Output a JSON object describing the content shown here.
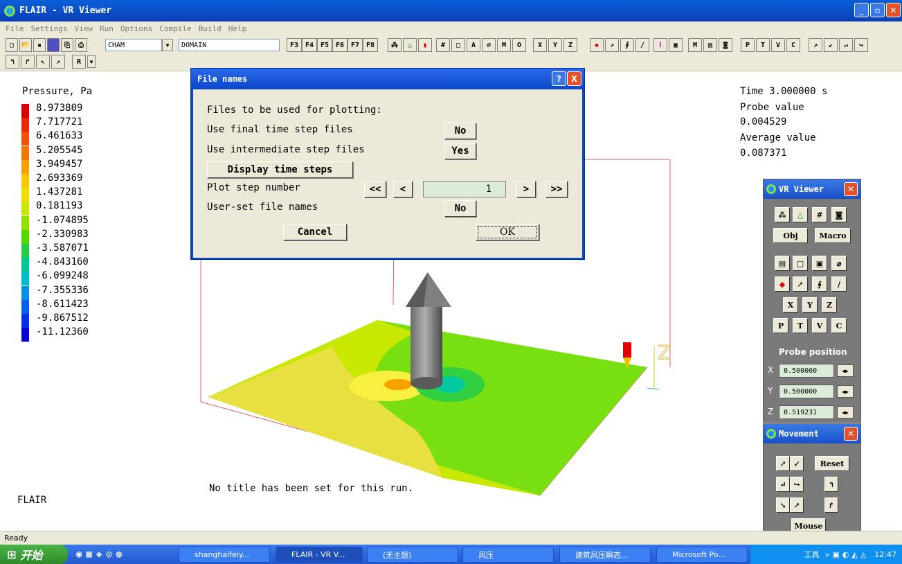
{
  "window": {
    "title": "FLAIR - VR Viewer"
  },
  "menu": [
    "File",
    "Settings",
    "View",
    "Run",
    "Options",
    "Compile",
    "Build",
    "Help"
  ],
  "toolbar": {
    "combo1": "CHAM",
    "combo2": "DOMAIN",
    "fkeys": [
      "F3",
      "F4",
      "F5",
      "F6",
      "F7",
      "F8"
    ],
    "letters": [
      "M",
      "O",
      "X",
      "Y",
      "Z",
      "M",
      "P",
      "T",
      "V",
      "C",
      "R"
    ]
  },
  "legend": {
    "title": "Pressure, Pa",
    "values": [
      "8.973809",
      "7.717721",
      "6.461633",
      "5.205545",
      "3.949457",
      "2.693369",
      "1.437281",
      "0.181193",
      "-1.074895",
      "-2.330983",
      "-3.587071",
      "-4.843160",
      "-6.099248",
      "-7.355336",
      "-8.611423",
      "-9.867512",
      "-11.12360"
    ],
    "colors": [
      "#d80000",
      "#e82800",
      "#f05000",
      "#f07800",
      "#f8a000",
      "#f8c800",
      "#f0e000",
      "#c8e800",
      "#90e000",
      "#50d800",
      "#20d040",
      "#00c890",
      "#00b8d0",
      "#0090e8",
      "#0060f0",
      "#0030e8",
      "#0000d8"
    ]
  },
  "info": {
    "time": "Time 3.000000 s",
    "probe_label": "Probe value",
    "probe_value": "0.004529",
    "avg_label": "Average value",
    "avg_value": "0.087371",
    "run_title": "No title has been set for this run.",
    "app_label": "FLAIR",
    "axis_z": "Z"
  },
  "dialog": {
    "title": "File names",
    "help": "?",
    "close": "X",
    "heading": "Files to be used for plotting:",
    "final_label": "Use final time step files",
    "final_value": "No",
    "intermediate_label": "Use intermediate step files",
    "intermediate_value": "Yes",
    "display_steps": "Display time steps",
    "step_label": "Plot step number",
    "step_first": "<<",
    "step_prev": "<",
    "step_value": "1",
    "step_next": ">",
    "step_last": ">>",
    "userset_label": "User-set file names",
    "userset_value": "No",
    "cancel": "Cancel",
    "ok": "OK"
  },
  "vr_panel": {
    "title": "VR Viewer",
    "obj": "Obj",
    "macro": "Macro",
    "x": "X",
    "y": "Y",
    "z": "Z",
    "p": "P",
    "t": "T",
    "v": "V",
    "c": "C",
    "probe_title": "Probe position",
    "probe_x": "0.500000",
    "probe_y": "0.500000",
    "probe_z": "0.519231"
  },
  "movement_panel": {
    "title": "Movement",
    "reset": "Reset",
    "mouse": "Mouse"
  },
  "statusbar": {
    "text": "Ready"
  },
  "taskbar": {
    "start": "开始",
    "tasks": [
      "shanghaifeiy...",
      "FLAIR - VR V...",
      "(无主题)",
      "风压",
      "建筑风压瞬态...",
      "Microsoft Po..."
    ],
    "tray_tools": "工具",
    "clock": "12:47"
  }
}
